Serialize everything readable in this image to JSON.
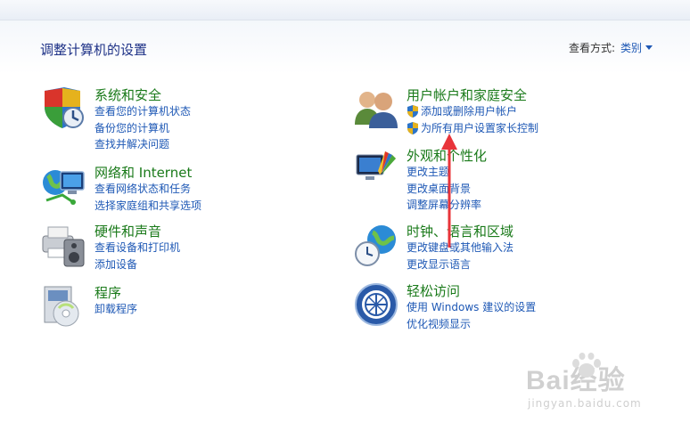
{
  "header": {
    "title": "调整计算机的设置",
    "view_label": "查看方式:",
    "view_value": "类别"
  },
  "left_categories": [
    {
      "title": "系统和安全",
      "links": [
        "查看您的计算机状态",
        "备份您的计算机",
        "查找并解决问题"
      ]
    },
    {
      "title": "网络和 Internet",
      "links": [
        "查看网络状态和任务",
        "选择家庭组和共享选项"
      ]
    },
    {
      "title": "硬件和声音",
      "links": [
        "查看设备和打印机",
        "添加设备"
      ]
    },
    {
      "title": "程序",
      "links": [
        "卸载程序"
      ]
    }
  ],
  "right_categories": [
    {
      "title": "用户帐户和家庭安全",
      "links": [
        "添加或删除用户帐户",
        "为所有用户设置家长控制"
      ]
    },
    {
      "title": "外观和个性化",
      "links": [
        "更改主题",
        "更改桌面背景",
        "调整屏幕分辨率"
      ]
    },
    {
      "title": "时钟、语言和区域",
      "links": [
        "更改键盘或其他输入法",
        "更改显示语言"
      ]
    },
    {
      "title": "轻松访问",
      "links": [
        "使用 Windows 建议的设置",
        "优化视频显示"
      ]
    }
  ],
  "watermark": {
    "brand": "Bai经验",
    "url": "jingyan.baidu.com"
  },
  "colors": {
    "title_green": "#1a7a1a",
    "link_blue": "#1e58b5",
    "heading_blue": "#1e3287",
    "arrow_red": "#e8343a"
  }
}
